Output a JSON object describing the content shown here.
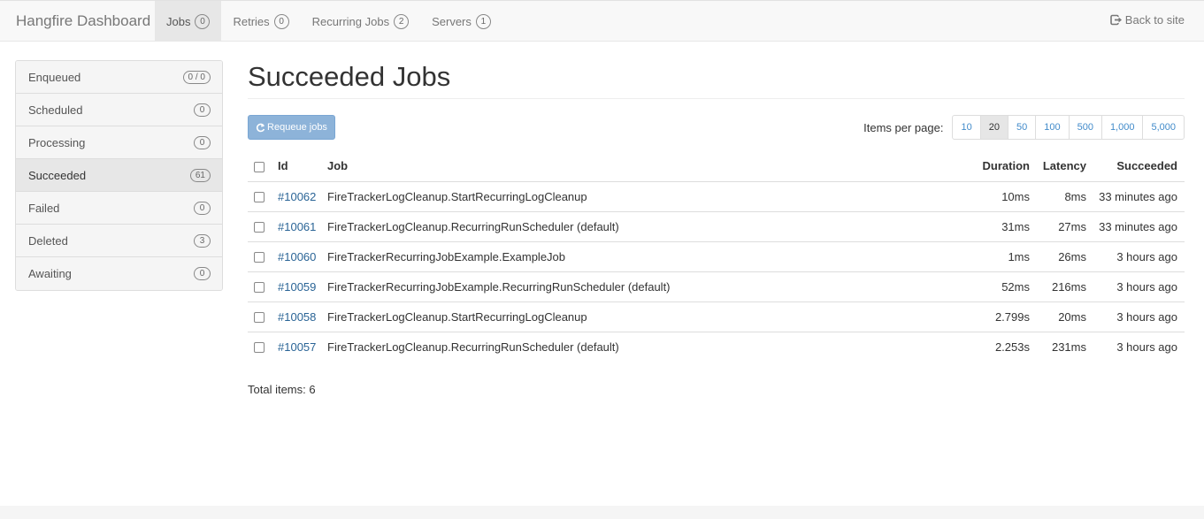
{
  "navbar": {
    "brand": "Hangfire Dashboard",
    "items": [
      {
        "label": "Jobs",
        "count": "0"
      },
      {
        "label": "Retries",
        "count": "0"
      },
      {
        "label": "Recurring Jobs",
        "count": "2"
      },
      {
        "label": "Servers",
        "count": "1"
      }
    ],
    "back_label": "Back to site"
  },
  "sidebar": {
    "items": [
      {
        "label": "Enqueued",
        "count": "0 / 0"
      },
      {
        "label": "Scheduled",
        "count": "0"
      },
      {
        "label": "Processing",
        "count": "0"
      },
      {
        "label": "Succeeded",
        "count": "61"
      },
      {
        "label": "Failed",
        "count": "0"
      },
      {
        "label": "Deleted",
        "count": "3"
      },
      {
        "label": "Awaiting",
        "count": "0"
      }
    ]
  },
  "main": {
    "title": "Succeeded Jobs",
    "requeue_label": "Requeue jobs",
    "items_per_page_label": "Items per page:",
    "page_sizes": [
      "10",
      "20",
      "50",
      "100",
      "500",
      "1,000",
      "5,000"
    ],
    "selected_page_size": "20",
    "table": {
      "headers": {
        "id": "Id",
        "job": "Job",
        "duration": "Duration",
        "latency": "Latency",
        "succeeded": "Succeeded"
      },
      "rows": [
        {
          "id": "#10062",
          "job": "FireTrackerLogCleanup.StartRecurringLogCleanup",
          "duration": "10ms",
          "latency": "8ms",
          "succeeded": "33 minutes ago"
        },
        {
          "id": "#10061",
          "job": "FireTrackerLogCleanup.RecurringRunScheduler (default)",
          "duration": "31ms",
          "latency": "27ms",
          "succeeded": "33 minutes ago"
        },
        {
          "id": "#10060",
          "job": "FireTrackerRecurringJobExample.ExampleJob",
          "duration": "1ms",
          "latency": "26ms",
          "succeeded": "3 hours ago"
        },
        {
          "id": "#10059",
          "job": "FireTrackerRecurringJobExample.RecurringRunScheduler (default)",
          "duration": "52ms",
          "latency": "216ms",
          "succeeded": "3 hours ago"
        },
        {
          "id": "#10058",
          "job": "FireTrackerLogCleanup.StartRecurringLogCleanup",
          "duration": "2.799s",
          "latency": "20ms",
          "succeeded": "3 hours ago"
        },
        {
          "id": "#10057",
          "job": "FireTrackerLogCleanup.RecurringRunScheduler (default)",
          "duration": "2.253s",
          "latency": "231ms",
          "succeeded": "3 hours ago"
        }
      ]
    },
    "total_label": "Total items: 6"
  },
  "colors": {
    "link": "#2a6496",
    "button": "#8db3d9",
    "navbar_bg": "#f8f8f8",
    "active_bg": "#e7e7e7"
  }
}
